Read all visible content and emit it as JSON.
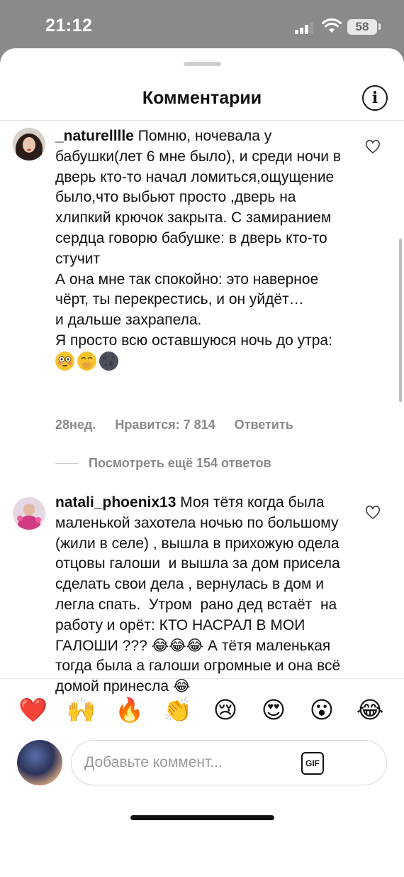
{
  "status_bar": {
    "time": "21:12",
    "battery": "58"
  },
  "header": {
    "title": "Комментарии"
  },
  "comments": [
    {
      "username": "_naturellllе",
      "text": " Помню, ночевала у бабушки(лет 6 мне было), и среди ночи в дверь кто-то начал ломиться,ощущение было,что выбьют просто ,дверь на хлипкий крючок закрыта. С замиранием сердца говорю бабушке: в дверь кто-то стучит\nА она мне так спокойно: это наверное чёрт, ты перекрестись, и он уйдёт…\nи дальше захрапела.\nЯ просто всю оставшуюся ночь до утра: ",
      "emojis": [
        "flushed-face",
        "face-with-hand-over-mouth",
        "new-moon-face"
      ],
      "time_ago": "28нед.",
      "likes": "Нравится: 7 814",
      "reply_label": "Ответить",
      "more_replies": "Посмотреть ещё 154 ответов"
    },
    {
      "username": "natali_phoenix13",
      "text": " Моя тётя когда была маленькой захотела ночью по большому (жили в селе) , вышла в прихожую одела отцовы галоши  и вышла за дом присела сделать свои дела , вернулась в дом и легла спать.  Утром  рано дед встаёт  на работу и орёт: КТО НАСРАЛ В МОИ ГАЛОШИ ??? 😂😂😂 А тётя маленькая тогда была а галоши огромные и она всё домой принесла 😂"
    }
  ],
  "reactions": [
    "❤️",
    "🙌",
    "🔥",
    "👏",
    "😢",
    "😍",
    "😮",
    "😂"
  ],
  "composer": {
    "placeholder": "Добавьте коммент...",
    "gif_label": "GIF"
  }
}
